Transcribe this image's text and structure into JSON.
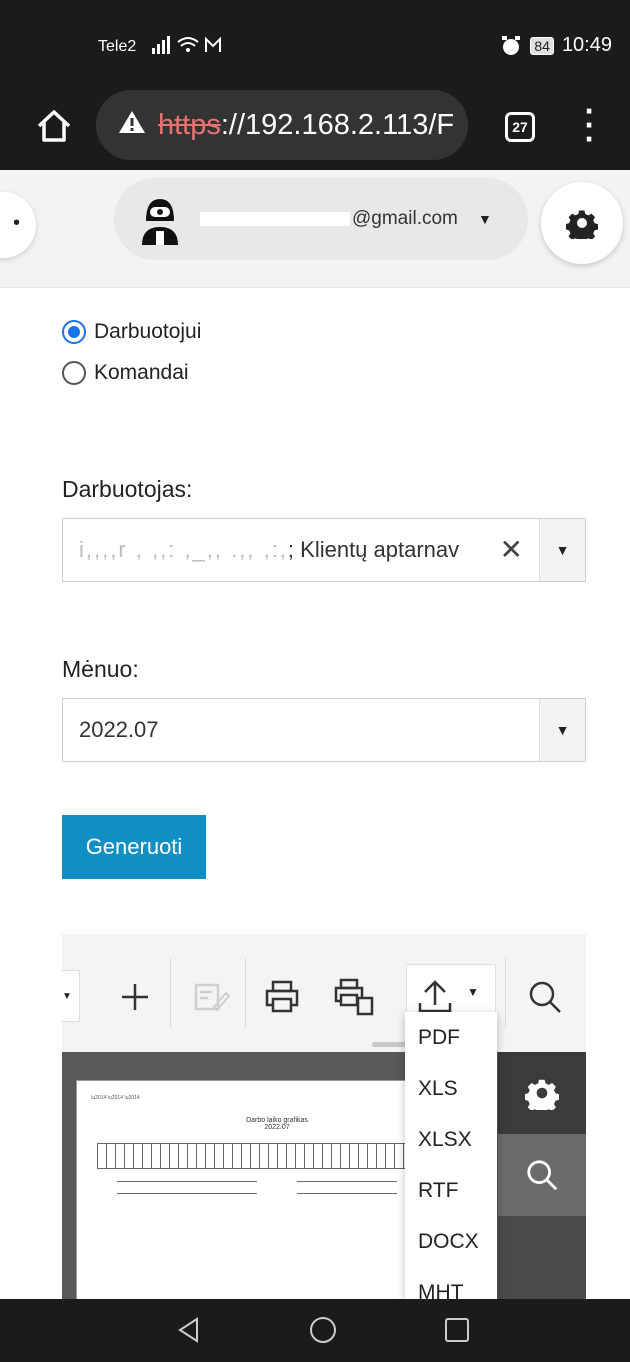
{
  "status_bar": {
    "carrier": "Tele2",
    "battery": "84",
    "time": "10:49"
  },
  "browser": {
    "url_scheme": "https",
    "url_rest": "://192.168.2.113/F",
    "tab_count": "27"
  },
  "header": {
    "email_suffix": "@gmail.com"
  },
  "form": {
    "radio_options": [
      {
        "label": "Darbuotojui",
        "checked": true
      },
      {
        "label": "Komandai",
        "checked": false
      }
    ],
    "employee_label": "Darbuotojas:",
    "employee_value_obscured": "i,,,,r , ,,: ,_,, .,, ,:,",
    "employee_value": "; Klientų aptarnav",
    "month_label": "Mėnuo:",
    "month_value": "2022.07",
    "generate_button": "Generuoti"
  },
  "viewer": {
    "sheet_title": "Darbo laiko grafikas",
    "sheet_subtitle": "2022.07",
    "export_options": [
      "PDF",
      "XLS",
      "XLSX",
      "RTF",
      "DOCX",
      "MHT"
    ]
  },
  "colors": {
    "primary_button": "#0f8fc4",
    "radio_selected": "#1a73e8",
    "system_bar": "#1b1b1b"
  }
}
